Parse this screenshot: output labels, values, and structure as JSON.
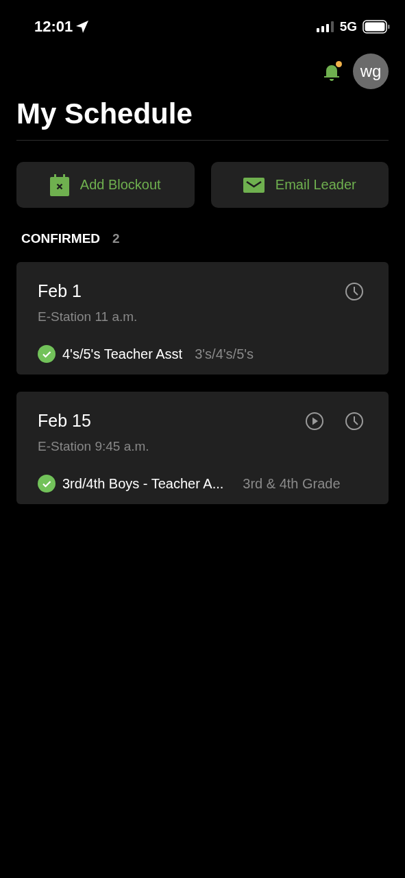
{
  "status_bar": {
    "time": "12:01",
    "network": "5G"
  },
  "header": {
    "notifications_unread": true,
    "avatar_initials": "wg"
  },
  "title": "My Schedule",
  "buttons": [
    {
      "kind": "blockout",
      "label": "Add Blockout"
    },
    {
      "kind": "email",
      "label": "Email Leader"
    }
  ],
  "section": {
    "label": "CONFIRMED",
    "count": "2"
  },
  "cards": [
    {
      "date": "Feb 1",
      "subtitle": "E-Station 11 a.m.",
      "actions": [
        {
          "kind": "clock"
        }
      ],
      "confirmed": true,
      "role": "4's/5's Teacher Asst",
      "group": "3's/4's/5's"
    },
    {
      "date": "Feb 15",
      "subtitle": "E-Station 9:45 a.m.",
      "actions": [
        {
          "kind": "play"
        },
        {
          "kind": "clock"
        }
      ],
      "confirmed": true,
      "role": "3rd/4th Boys - Teacher A...",
      "group": "3rd & 4th Grade"
    }
  ]
}
